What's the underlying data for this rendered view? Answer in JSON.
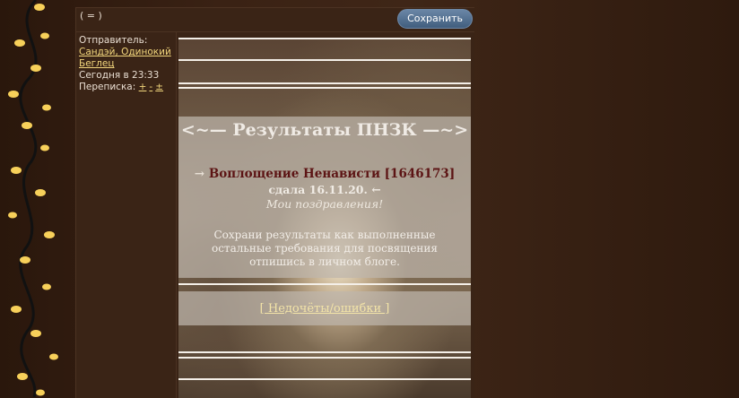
{
  "topbar": {
    "marker": "( = )",
    "save_label": "Сохранить"
  },
  "sidebar": {
    "sender_label": "Отправитель:",
    "sender_name": "Сандэй, Одинокий Беглец",
    "time": "Сегодня в 23:33",
    "correspondence_label": "Переписка:",
    "actions": [
      "+",
      "-",
      "±"
    ]
  },
  "post": {
    "heading": "<~— Результаты ПНЗК —~>",
    "arrow_left": "→",
    "work_title": "Воплощение Ненависти [1646173]",
    "passed_text": "сдала 16.11.20. ←",
    "congrats": "Мои поздравления!",
    "note": "Сохрани результаты как выполненные остальные требования для посвящения отпишись в личном блоге.",
    "link": "[ Недочёты/ошибки ]"
  }
}
